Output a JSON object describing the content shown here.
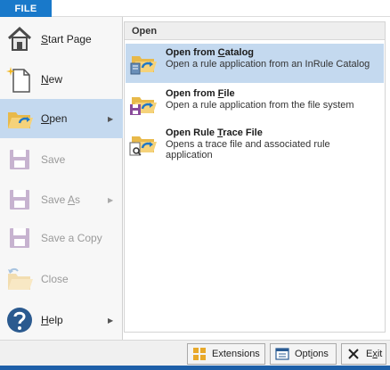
{
  "file_tab": {
    "label": "FILE"
  },
  "menu": {
    "items": [
      {
        "label": "Start Page",
        "underline": "S",
        "rest": "tart Page"
      },
      {
        "label": "New",
        "underline": "N",
        "rest": "ew"
      },
      {
        "label": "Open",
        "underline": "O",
        "rest": "pen"
      },
      {
        "label": "Save"
      },
      {
        "label": "Save As",
        "prefix": "Save ",
        "underline": "A",
        "rest": "s"
      },
      {
        "label": "Save a Copy"
      },
      {
        "label": "Close"
      },
      {
        "label": "Help",
        "underline": "H",
        "rest": "elp"
      }
    ]
  },
  "open_panel": {
    "header": "Open",
    "options": [
      {
        "title_prefix": "Open from ",
        "title_underline": "C",
        "title_rest": "atalog",
        "desc": "Open a rule application from an InRule Catalog"
      },
      {
        "title_prefix": "Open from ",
        "title_underline": "F",
        "title_rest": "ile",
        "desc": "Open a rule application from the file system"
      },
      {
        "title_prefix": "Open Rule ",
        "title_underline": "T",
        "title_rest": "race File",
        "desc": "Opens a trace file and associated rule application"
      }
    ]
  },
  "footer": {
    "extensions": "Extensions",
    "options_prefix": "Opt",
    "options_underline": "i",
    "options_rest": "ons",
    "exit_prefix": "E",
    "exit_underline": "x",
    "exit_rest": "it"
  },
  "colors": {
    "accent": "#1979ca",
    "selection": "#c4d9ef",
    "status": "#1d5fa8"
  }
}
